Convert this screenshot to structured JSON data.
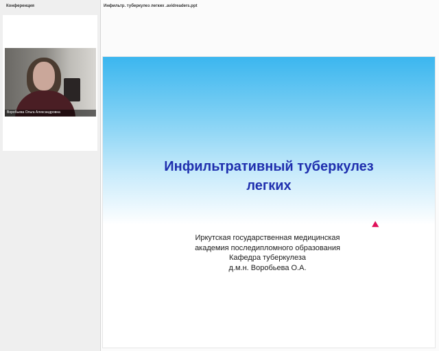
{
  "left_panel": {
    "title": "Конференция",
    "participant": {
      "name": "Воробьева Ольга Александровна"
    }
  },
  "main": {
    "document_title": "Инфильтр. туберкулез легких  .avidreaders.ppt",
    "slide": {
      "title_lines": [
        "Инфильтративный туберкулез",
        "легких"
      ],
      "subtitle_lines": [
        "Иркутская государственная медицинская",
        "академия последипломного образования",
        "Кафедра туберкулеза",
        "д.м.н. Воробьева О.А."
      ]
    }
  },
  "colors": {
    "slide_title": "#1f2fae",
    "slide_gradient_top": "#3bb6ef",
    "pointer": "#e0105a"
  },
  "icons": {
    "pointer": "laser-pointer-icon"
  }
}
